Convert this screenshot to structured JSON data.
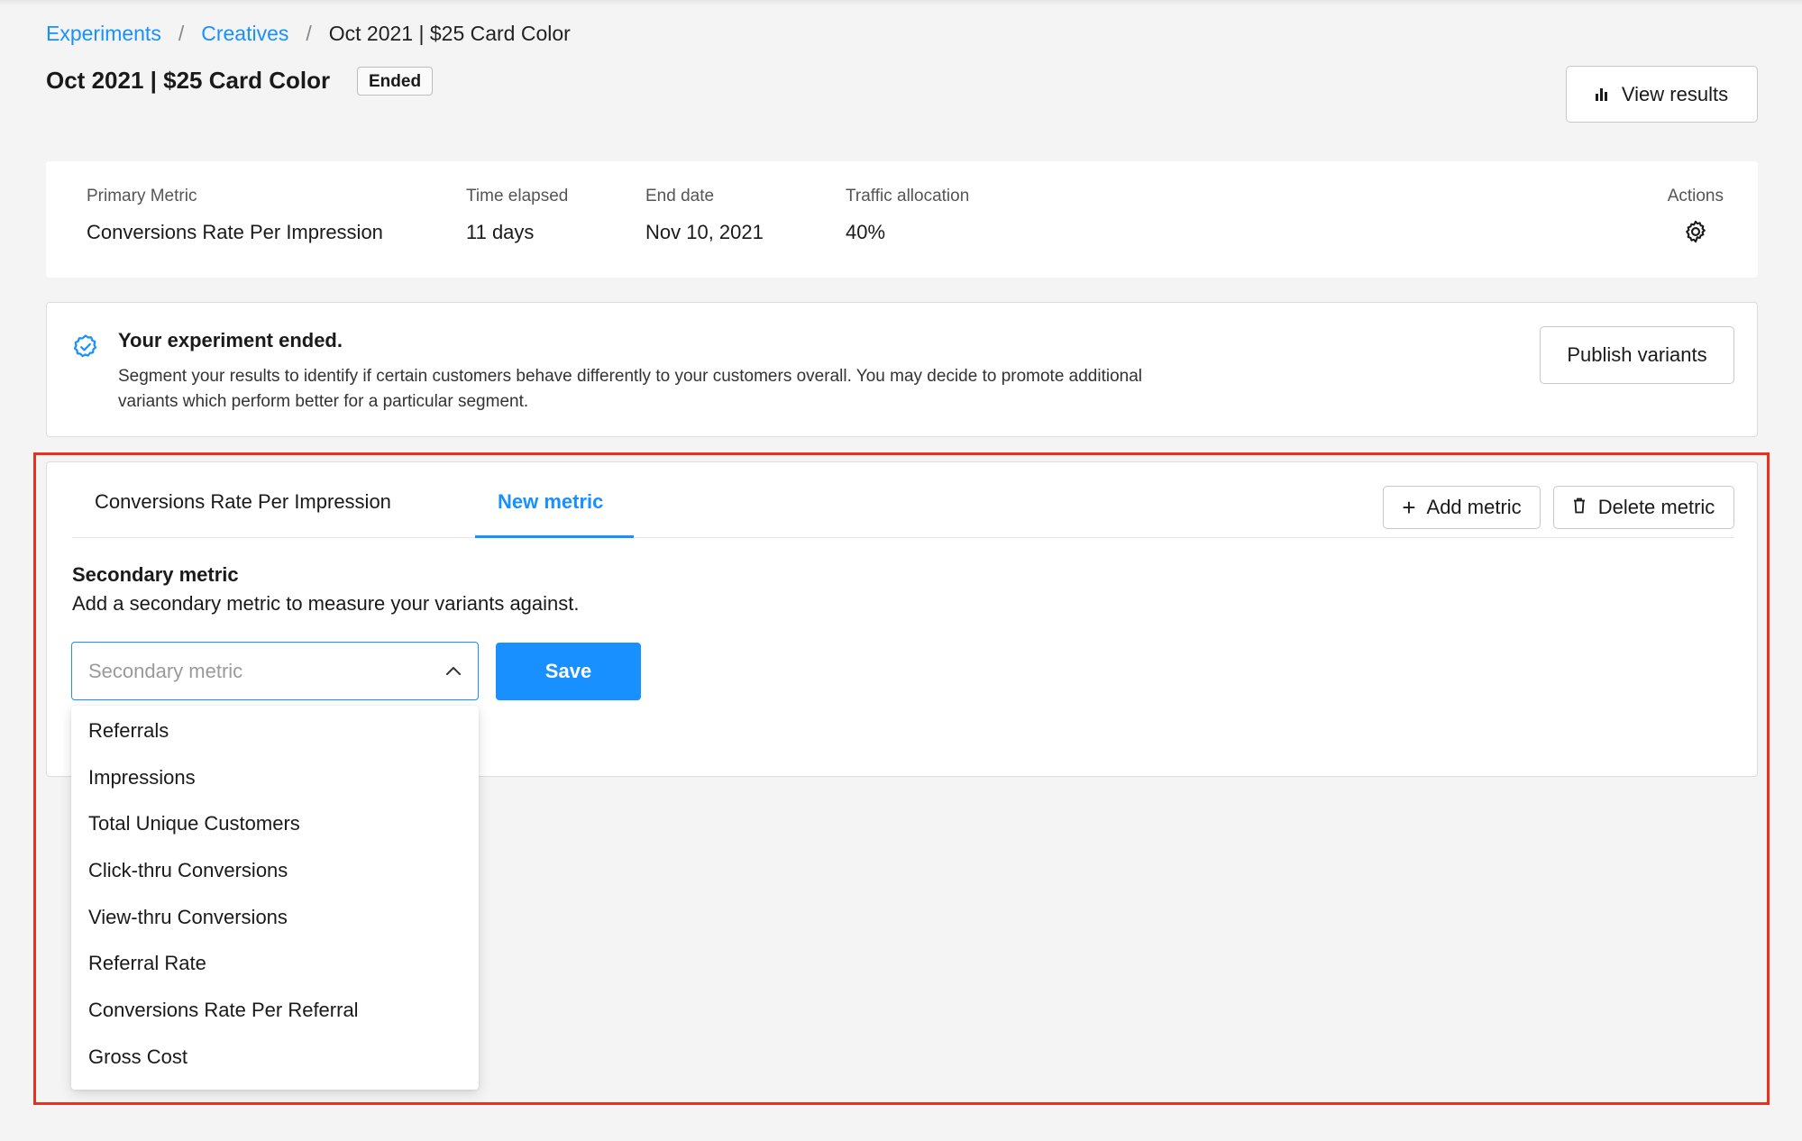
{
  "breadcrumb": {
    "items": [
      "Experiments",
      "Creatives"
    ],
    "separator": "/",
    "current": "Oct 2021 | $25 Card Color"
  },
  "header": {
    "title": "Oct 2021 | $25 Card Color",
    "status": "Ended",
    "view_results_label": "View results",
    "view_results_icon": "bar-chart-icon"
  },
  "summary": {
    "primary_metric_label": "Primary Metric",
    "primary_metric_value": "Conversions Rate Per Impression",
    "time_elapsed_label": "Time elapsed",
    "time_elapsed_value": "11 days",
    "end_date_label": "End date",
    "end_date_value": "Nov 10, 2021",
    "traffic_label": "Traffic allocation",
    "traffic_value": "40%",
    "actions_label": "Actions",
    "actions_icon": "gear-icon"
  },
  "alert": {
    "icon": "check-badge-icon",
    "title": "Your experiment ended.",
    "body": "Segment your results to identify if certain customers behave differently to your customers overall. You may decide to promote additional variants which perform better for a particular segment.",
    "publish_label": "Publish variants"
  },
  "metrics": {
    "tabs": [
      {
        "label": "Conversions Rate Per Impression",
        "active": false
      },
      {
        "label": "New metric",
        "active": true
      }
    ],
    "add_metric_label": "Add metric",
    "delete_metric_label": "Delete metric",
    "section_title": "Secondary metric",
    "section_desc": "Add a secondary metric to measure your variants against.",
    "select_placeholder": "Secondary metric",
    "save_label": "Save",
    "options": [
      "Referrals",
      "Impressions",
      "Total Unique Customers",
      "Click-thru Conversions",
      "View-thru Conversions",
      "Referral Rate",
      "Conversions Rate Per Referral",
      "Gross Cost"
    ]
  },
  "colors": {
    "accent": "#1890ff",
    "highlight_frame": "#e8321e",
    "background": "#f4f4f4"
  }
}
